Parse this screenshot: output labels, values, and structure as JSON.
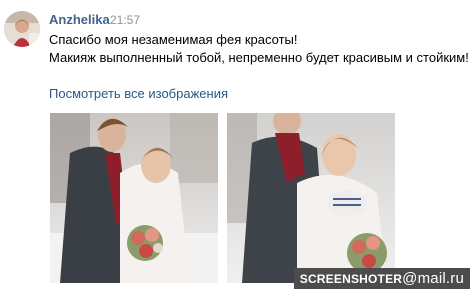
{
  "message": {
    "author": "Anzhelika",
    "time": "21:57",
    "line1": "Спасибо моя незаменимая фея красоты!",
    "line2": "Макияж выполненный тобой, непременно будет красивым и стойким!",
    "view_all_link": "Посмотреть все изображения"
  },
  "photos": [
    {
      "name": "wedding-photo-1"
    },
    {
      "name": "wedding-photo-2"
    }
  ],
  "watermark": {
    "prefix": "SCREENSHOTER",
    "suffix": "@mail.ru"
  }
}
